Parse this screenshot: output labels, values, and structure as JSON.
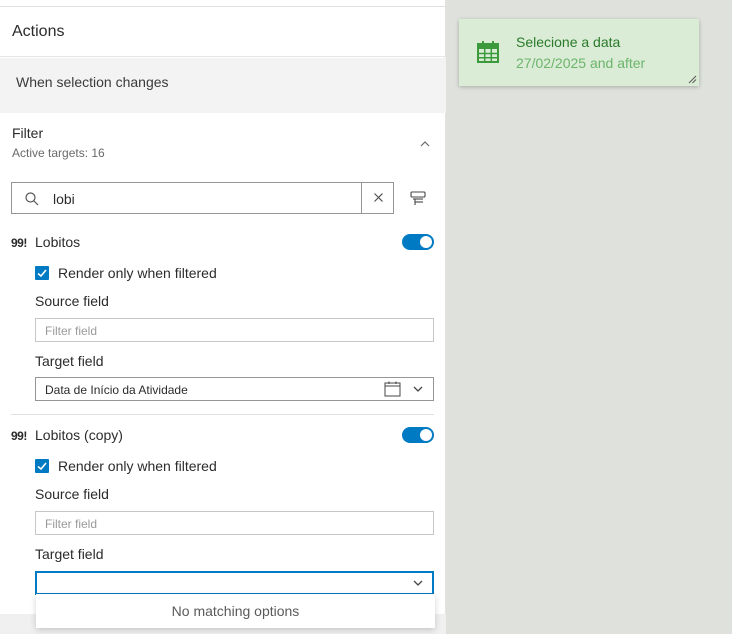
{
  "panel": {
    "title": "Actions",
    "trigger_label": "When selection changes",
    "filter": {
      "title": "Filter",
      "active_targets": "Active targets: 16"
    },
    "search": {
      "value": "lobi"
    },
    "targets": [
      {
        "icon_glyph": "99!",
        "name": "Lobitos",
        "enabled": true,
        "render_only_when_filtered_label": "Render only when filtered",
        "render_only_when_filtered": true,
        "source_field_label": "Source field",
        "source_field_placeholder": "Filter field",
        "target_field_label": "Target field",
        "target_field_value": "Data de Início da Atividade"
      },
      {
        "icon_glyph": "99!",
        "name": "Lobitos (copy)",
        "enabled": true,
        "render_only_when_filtered_label": "Render only when filtered",
        "render_only_when_filtered": true,
        "source_field_label": "Source field",
        "source_field_placeholder": "Filter field",
        "target_field_label": "Target field",
        "target_field_value": ""
      }
    ],
    "dropdown_message": "No matching options"
  },
  "date_widget": {
    "title": "Selecione a data",
    "value": "27/02/2025 and after",
    "icon": "calendar-icon"
  },
  "colors": {
    "accent": "#007ac2",
    "widget_bg": "#daecd6",
    "widget_title": "#2a7a2a",
    "widget_value": "#6cb46c",
    "canvas_bg": "#dfe2dc"
  }
}
